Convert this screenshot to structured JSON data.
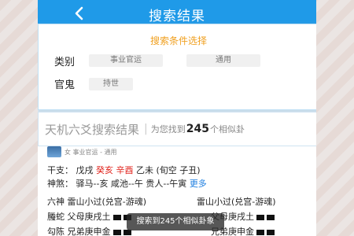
{
  "header": {
    "title": "搜索结果"
  },
  "conditions": {
    "title": "搜索条件选择",
    "rows": [
      {
        "label": "类别",
        "chips": [
          "事业官运",
          "通用"
        ]
      },
      {
        "label": "官鬼",
        "chips": [
          "持世"
        ]
      }
    ]
  },
  "results": {
    "heading": "天机六爻搜索结果",
    "separator": "|",
    "prefix": "为您找到",
    "count": "245",
    "suffix": "个相似卦"
  },
  "item": {
    "meta": "女 事业官运 - 通用",
    "ganzhi_label": "干支：",
    "ganzhi_a": "戊戌",
    "ganzhi_b": "癸亥 辛酉",
    "ganzhi_c": "乙未 (旬空 子丑)",
    "shensha_label": "神煞：",
    "shensha_text": "驿马--亥  咸池--午  贵人--午寅",
    "more": "更多",
    "gua_left": "六神 雷山小过(兑宫-游魂)",
    "gua_right": "雷山小过(兑宫-游魂)",
    "line1_left": "螣蛇 父母庚戌土",
    "line1_right": "父母庚戌土",
    "line2_left": "勾陈 兄弟庚申金",
    "line2_right": "兄弟庚申金"
  },
  "toast": "搜索到245个相似卦象",
  "colors": {
    "titlebar": "#1f9ae8",
    "accent": "#f0a020",
    "highlight": "#e0211a",
    "link": "#1f7fe0"
  }
}
